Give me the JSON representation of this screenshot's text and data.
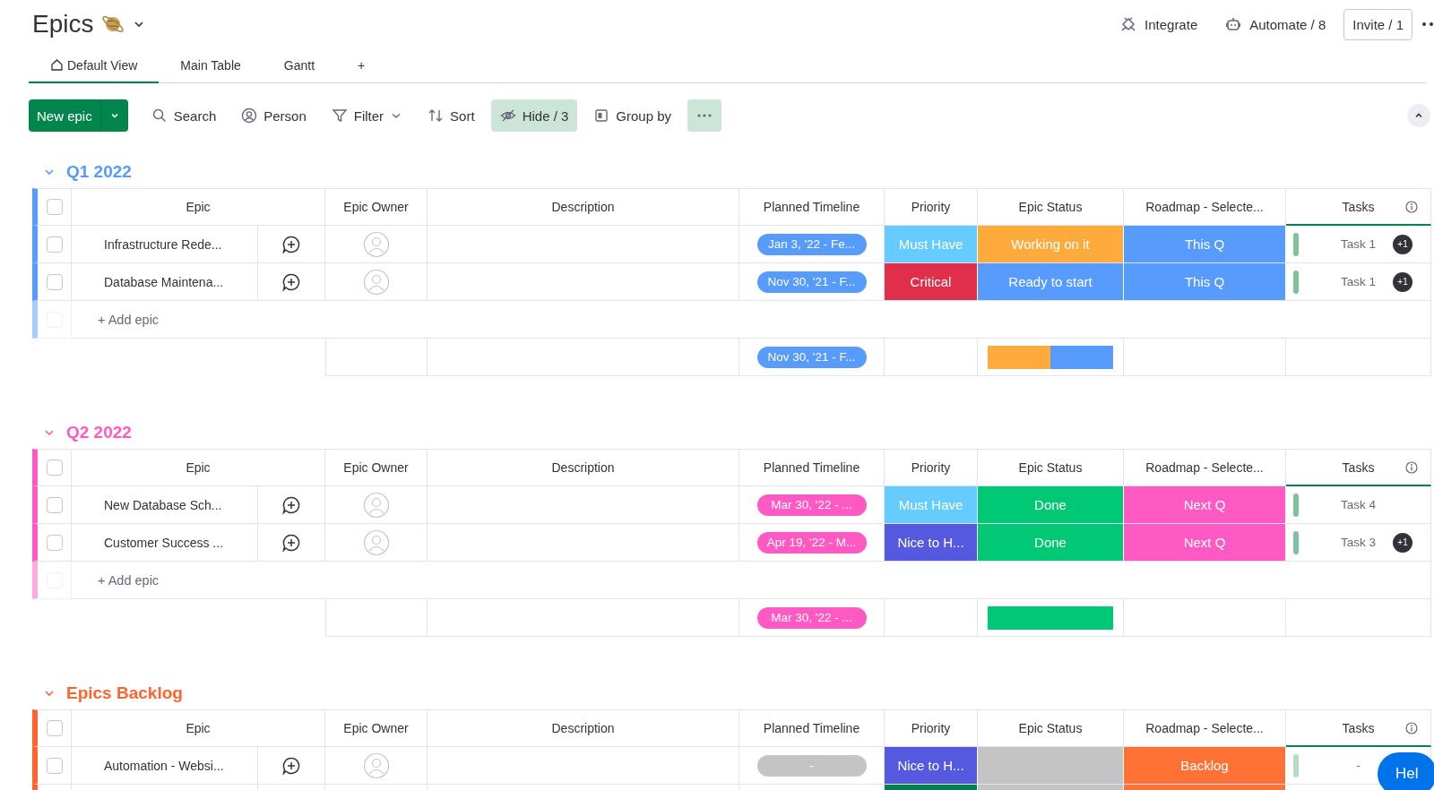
{
  "board": {
    "title": "Epics"
  },
  "header_actions": [
    {
      "kind": "integrate",
      "label": "Integrate"
    },
    {
      "kind": "automate",
      "label": "Automate / 8"
    },
    {
      "kind": "invite",
      "label": "Invite / 1"
    }
  ],
  "tabs": [
    {
      "label": "Default View",
      "selected": true,
      "home": true
    },
    {
      "label": "Main Table",
      "selected": false,
      "home": false
    },
    {
      "label": "Gantt",
      "selected": false,
      "home": false
    },
    {
      "label": "+",
      "selected": false,
      "home": false
    }
  ],
  "new_button": {
    "label": "New epic"
  },
  "toolbar": [
    {
      "kind": "search",
      "label": "Search",
      "active": false,
      "dropdown": false
    },
    {
      "kind": "person",
      "label": "Person",
      "active": false,
      "dropdown": false
    },
    {
      "kind": "filter",
      "label": "Filter",
      "active": false,
      "dropdown": true
    },
    {
      "kind": "sort",
      "label": "Sort",
      "active": false,
      "dropdown": false
    },
    {
      "kind": "hide",
      "label": "Hide / 3",
      "active": true,
      "dropdown": false
    },
    {
      "kind": "group",
      "label": "Group by",
      "active": false,
      "dropdown": false
    },
    {
      "kind": "more",
      "active": true,
      "dropdown": false
    }
  ],
  "groups": [
    {
      "title": "Q1 2022",
      "color": "#579bfc",
      "columns": [
        "Epic",
        "Epic Owner",
        "Description",
        "Planned Timeline",
        "Priority",
        "Epic Status",
        "Roadmap - Selecte...",
        "Tasks"
      ],
      "header_checked": false,
      "rows": [
        {
          "checked": false,
          "epic": "Infrastructure Rede...",
          "timeline": {
            "text": "Jan 3, '22 - Fe...",
            "color": "#579bfc"
          },
          "priority": {
            "text": "Must Have",
            "color": "#66ccff"
          },
          "status": {
            "text": "Working on it",
            "color": "#fdab3d"
          },
          "roadmap": {
            "text": "This Q",
            "color": "#579bfc"
          },
          "tasks": {
            "text": "Task 1",
            "badge": "+1",
            "faded": false
          }
        },
        {
          "checked": false,
          "epic": "Database Maintena...",
          "timeline": {
            "text": "Nov 30, '21 - F...",
            "color": "#579bfc"
          },
          "priority": {
            "text": "Critical",
            "color": "#df2f4a"
          },
          "status": {
            "text": "Ready to start",
            "color": "#579bfc"
          },
          "roadmap": {
            "text": "This Q",
            "color": "#579bfc"
          },
          "tasks": {
            "text": "Task 1",
            "badge": "+1",
            "faded": false
          }
        }
      ],
      "add_row": {
        "label": "+ Add epic",
        "checked": false
      },
      "summary": {
        "timeline": {
          "text": "Nov 30, '21 - F...",
          "color": "#579bfc"
        },
        "status_bar": [
          {
            "color": "#fdab3d",
            "level": 0.5
          },
          {
            "color": "#579bfc",
            "level": 0.5
          }
        ]
      }
    },
    {
      "title": "Q2 2022",
      "color": "#ff5ac4",
      "columns": [
        "Epic",
        "Epic Owner",
        "Description",
        "Planned Timeline",
        "Priority",
        "Epic Status",
        "Roadmap - Selecte...",
        "Tasks"
      ],
      "header_checked": false,
      "rows": [
        {
          "checked": false,
          "epic": "New Database Sch...",
          "timeline": {
            "text": "Mar 30, '22 - ...",
            "color": "#ff5ac4"
          },
          "priority": {
            "text": "Must Have",
            "color": "#66ccff"
          },
          "status": {
            "text": "Done",
            "color": "#00c875"
          },
          "roadmap": {
            "text": "Next Q",
            "color": "#ff5ac4"
          },
          "tasks": {
            "text": "Task 4",
            "faded": false
          }
        },
        {
          "checked": false,
          "epic": "Customer Success ...",
          "timeline": {
            "text": "Apr 19, '22 - M...",
            "color": "#ff5ac4"
          },
          "priority": {
            "text": "Nice to H...",
            "color": "#5559df"
          },
          "status": {
            "text": "Done",
            "color": "#00c875"
          },
          "roadmap": {
            "text": "Next Q",
            "color": "#ff5ac4"
          },
          "tasks": {
            "text": "Task 3",
            "badge": "+1",
            "faded": false
          }
        }
      ],
      "add_row": {
        "label": "+ Add epic",
        "checked": false
      },
      "summary": {
        "timeline": {
          "text": "Mar 30, '22 - ...",
          "color": "#ff5ac4"
        },
        "status_bar": [
          {
            "color": "#00c875"
          }
        ]
      }
    },
    {
      "title": "Epics Backlog",
      "color": "#ff642e",
      "columns": [
        "Epic",
        "Epic Owner",
        "Description",
        "Planned Timeline",
        "Priority",
        "Epic Status",
        "Roadmap - Selecte...",
        "Tasks"
      ],
      "header_checked": false,
      "rows": [
        {
          "checked": false,
          "epic": "Automation - Websi...",
          "timeline": {
            "text": "-",
            "color": "#c4c4c4"
          },
          "priority": {
            "text": "Nice to H...",
            "color": "#5559df"
          },
          "status": {
            "color": "#c4c4c4"
          },
          "roadmap": {
            "text": "Backlog",
            "color": "#ff7134"
          },
          "tasks": {
            "text": "-",
            "faded": true
          }
        },
        {
          "priority": {
            "color": "#037f4c"
          },
          "status": {
            "color": "#c4c4c4"
          },
          "roadmap": {
            "color": "#ff7134"
          }
        }
      ]
    }
  ],
  "help_button": {
    "label": "Hel"
  }
}
